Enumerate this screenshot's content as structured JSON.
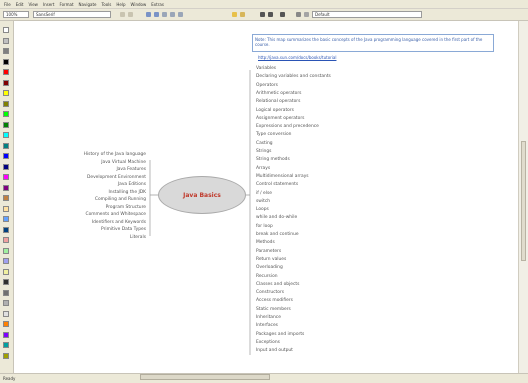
{
  "menubar": {
    "items": [
      "File",
      "Edit",
      "View",
      "Insert",
      "Format",
      "Navigate",
      "Tools",
      "Help",
      "Window",
      "Extras"
    ]
  },
  "toolbar": {
    "zoom_value": "100%",
    "font_value": "SansSerif",
    "style_value": "Default"
  },
  "palette": {
    "colors": [
      "#ffffff",
      "#c0c0c0",
      "#808080",
      "#000000",
      "#ff0000",
      "#800000",
      "#ffff00",
      "#808000",
      "#00ff00",
      "#008000",
      "#00ffff",
      "#008080",
      "#0000ff",
      "#000080",
      "#ff00ff",
      "#800080",
      "#c08040",
      "#ffe0a0",
      "#60a0ff",
      "#004080",
      "#f0a0a0",
      "#a0f0a0",
      "#a0a0f0",
      "#f0f0a0",
      "#303030",
      "#707070",
      "#b0b0b0",
      "#e0e0e0",
      "#ff8000",
      "#8000ff",
      "#00a0a0",
      "#a0a000"
    ]
  },
  "central_node": {
    "label": "Java Basics"
  },
  "left_nodes": [
    "History of the Java language",
    "Java Virtual Machine",
    "Java Features",
    "Development Environment",
    "Java Editions",
    "Installing the JDK",
    "Compiling and Running",
    "Program Structure",
    "Comments and Whitespace",
    "Identifiers and Keywords",
    "Primitive Data Types",
    "Literals"
  ],
  "right_nodes": [
    "Variables",
    "Declaring variables and constants",
    "Operators",
    "Arithmetic operators",
    "Relational operators",
    "Logical operators",
    "Assignment operators",
    "Expressions and precedence",
    "Type conversion",
    "Casting",
    "Strings",
    "String methods",
    "Arrays",
    "Multidimensional arrays",
    "Control statements",
    "if / else",
    "switch",
    "Loops",
    "while and do-while",
    "for loop",
    "break and continue",
    "Methods",
    "Parameters",
    "Return values",
    "Overloading",
    "Recursion",
    "Classes and objects",
    "Constructors",
    "Access modifiers",
    "Static members",
    "Inheritance",
    "Interfaces",
    "Packages and imports",
    "Exceptions",
    "Input and output"
  ],
  "note": {
    "text": "Note: This map summarizes the basic concepts of the Java programming language covered in the first part of the course.",
    "link": "http://java.sun.com/docs/books/tutorial"
  },
  "status": {
    "text": "Ready"
  }
}
